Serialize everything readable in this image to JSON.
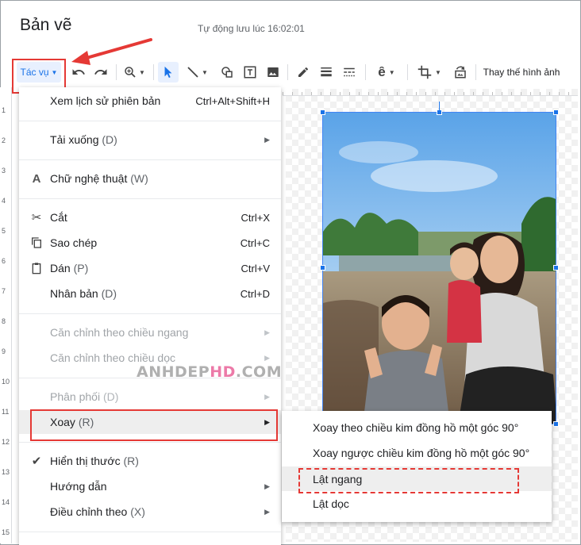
{
  "header": {
    "title": "Bản vẽ",
    "autosave": "Tự động lưu lúc 16:02:01"
  },
  "toolbar": {
    "actions_label": "Tác vụ",
    "replace_image_label": "Thay thế hình ảnh"
  },
  "ruler_left": [
    "1",
    "2",
    "3",
    "4",
    "5",
    "6",
    "7",
    "8",
    "9",
    "10",
    "11",
    "12",
    "13",
    "14",
    "15"
  ],
  "watermark": {
    "part1": "ANHDEP",
    "part2": "HD",
    "part3": ".COM"
  },
  "menu": {
    "version_history": {
      "label": "Xem lịch sử phiên bản",
      "shortcut": "Ctrl+Alt+Shift+H"
    },
    "download": {
      "label": "Tải xuống",
      "accel": "(D)"
    },
    "word_art": {
      "label": "Chữ nghệ thuật",
      "accel": "(W)"
    },
    "cut": {
      "label": "Cắt",
      "shortcut": "Ctrl+X"
    },
    "copy": {
      "label": "Sao chép",
      "shortcut": "Ctrl+C"
    },
    "paste": {
      "label": "Dán",
      "accel": "(P)",
      "shortcut": "Ctrl+V"
    },
    "duplicate": {
      "label": "Nhân bản",
      "accel": "(D)",
      "shortcut": "Ctrl+D"
    },
    "align_horizontal": {
      "label": "Căn chỉnh theo chiều ngang"
    },
    "align_vertical": {
      "label": "Căn chỉnh theo chiều dọc"
    },
    "distribute": {
      "label": "Phân phối",
      "accel": "(D)"
    },
    "rotate": {
      "label": "Xoay",
      "accel": "(R)"
    },
    "show_ruler": {
      "label": "Hiển thị thước",
      "accel": "(R)"
    },
    "guides": {
      "label": "Hướng dẫn"
    },
    "snap_to": {
      "label": "Điều chỉnh theo",
      "accel": "(X)"
    }
  },
  "submenu": {
    "rotate_cw": "Xoay theo chiều kim đồng hồ một góc 90°",
    "rotate_ccw": "Xoay ngược chiều kim đồng hồ một góc 90°",
    "flip_horizontal": "Lật ngang",
    "flip_vertical": "Lật dọc"
  },
  "colors": {
    "accent": "#1a73e8",
    "highlight": "#e53935"
  }
}
